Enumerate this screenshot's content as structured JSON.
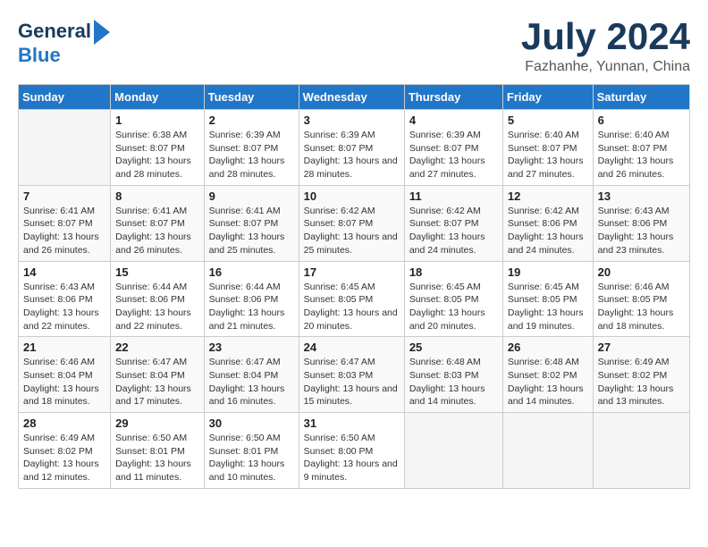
{
  "logo": {
    "line1": "General",
    "line2": "Blue"
  },
  "title": "July 2024",
  "subtitle": "Fazhanhe, Yunnan, China",
  "days_header": [
    "Sunday",
    "Monday",
    "Tuesday",
    "Wednesday",
    "Thursday",
    "Friday",
    "Saturday"
  ],
  "weeks": [
    [
      {
        "day": "",
        "text": ""
      },
      {
        "day": "1",
        "text": "Sunrise: 6:38 AM\nSunset: 8:07 PM\nDaylight: 13 hours and 28 minutes."
      },
      {
        "day": "2",
        "text": "Sunrise: 6:39 AM\nSunset: 8:07 PM\nDaylight: 13 hours and 28 minutes."
      },
      {
        "day": "3",
        "text": "Sunrise: 6:39 AM\nSunset: 8:07 PM\nDaylight: 13 hours and 28 minutes."
      },
      {
        "day": "4",
        "text": "Sunrise: 6:39 AM\nSunset: 8:07 PM\nDaylight: 13 hours and 27 minutes."
      },
      {
        "day": "5",
        "text": "Sunrise: 6:40 AM\nSunset: 8:07 PM\nDaylight: 13 hours and 27 minutes."
      },
      {
        "day": "6",
        "text": "Sunrise: 6:40 AM\nSunset: 8:07 PM\nDaylight: 13 hours and 26 minutes."
      }
    ],
    [
      {
        "day": "7",
        "text": "Sunrise: 6:41 AM\nSunset: 8:07 PM\nDaylight: 13 hours and 26 minutes."
      },
      {
        "day": "8",
        "text": "Sunrise: 6:41 AM\nSunset: 8:07 PM\nDaylight: 13 hours and 26 minutes."
      },
      {
        "day": "9",
        "text": "Sunrise: 6:41 AM\nSunset: 8:07 PM\nDaylight: 13 hours and 25 minutes."
      },
      {
        "day": "10",
        "text": "Sunrise: 6:42 AM\nSunset: 8:07 PM\nDaylight: 13 hours and 25 minutes."
      },
      {
        "day": "11",
        "text": "Sunrise: 6:42 AM\nSunset: 8:07 PM\nDaylight: 13 hours and 24 minutes."
      },
      {
        "day": "12",
        "text": "Sunrise: 6:42 AM\nSunset: 8:06 PM\nDaylight: 13 hours and 24 minutes."
      },
      {
        "day": "13",
        "text": "Sunrise: 6:43 AM\nSunset: 8:06 PM\nDaylight: 13 hours and 23 minutes."
      }
    ],
    [
      {
        "day": "14",
        "text": "Sunrise: 6:43 AM\nSunset: 8:06 PM\nDaylight: 13 hours and 22 minutes."
      },
      {
        "day": "15",
        "text": "Sunrise: 6:44 AM\nSunset: 8:06 PM\nDaylight: 13 hours and 22 minutes."
      },
      {
        "day": "16",
        "text": "Sunrise: 6:44 AM\nSunset: 8:06 PM\nDaylight: 13 hours and 21 minutes."
      },
      {
        "day": "17",
        "text": "Sunrise: 6:45 AM\nSunset: 8:05 PM\nDaylight: 13 hours and 20 minutes."
      },
      {
        "day": "18",
        "text": "Sunrise: 6:45 AM\nSunset: 8:05 PM\nDaylight: 13 hours and 20 minutes."
      },
      {
        "day": "19",
        "text": "Sunrise: 6:45 AM\nSunset: 8:05 PM\nDaylight: 13 hours and 19 minutes."
      },
      {
        "day": "20",
        "text": "Sunrise: 6:46 AM\nSunset: 8:05 PM\nDaylight: 13 hours and 18 minutes."
      }
    ],
    [
      {
        "day": "21",
        "text": "Sunrise: 6:46 AM\nSunset: 8:04 PM\nDaylight: 13 hours and 18 minutes."
      },
      {
        "day": "22",
        "text": "Sunrise: 6:47 AM\nSunset: 8:04 PM\nDaylight: 13 hours and 17 minutes."
      },
      {
        "day": "23",
        "text": "Sunrise: 6:47 AM\nSunset: 8:04 PM\nDaylight: 13 hours and 16 minutes."
      },
      {
        "day": "24",
        "text": "Sunrise: 6:47 AM\nSunset: 8:03 PM\nDaylight: 13 hours and 15 minutes."
      },
      {
        "day": "25",
        "text": "Sunrise: 6:48 AM\nSunset: 8:03 PM\nDaylight: 13 hours and 14 minutes."
      },
      {
        "day": "26",
        "text": "Sunrise: 6:48 AM\nSunset: 8:02 PM\nDaylight: 13 hours and 14 minutes."
      },
      {
        "day": "27",
        "text": "Sunrise: 6:49 AM\nSunset: 8:02 PM\nDaylight: 13 hours and 13 minutes."
      }
    ],
    [
      {
        "day": "28",
        "text": "Sunrise: 6:49 AM\nSunset: 8:02 PM\nDaylight: 13 hours and 12 minutes."
      },
      {
        "day": "29",
        "text": "Sunrise: 6:50 AM\nSunset: 8:01 PM\nDaylight: 13 hours and 11 minutes."
      },
      {
        "day": "30",
        "text": "Sunrise: 6:50 AM\nSunset: 8:01 PM\nDaylight: 13 hours and 10 minutes."
      },
      {
        "day": "31",
        "text": "Sunrise: 6:50 AM\nSunset: 8:00 PM\nDaylight: 13 hours and 9 minutes."
      },
      {
        "day": "",
        "text": ""
      },
      {
        "day": "",
        "text": ""
      },
      {
        "day": "",
        "text": ""
      }
    ]
  ]
}
